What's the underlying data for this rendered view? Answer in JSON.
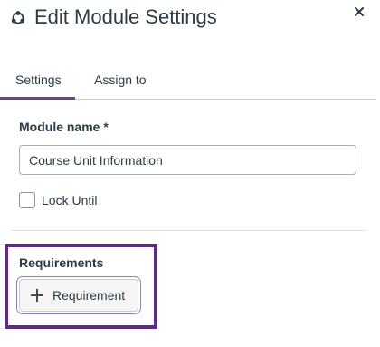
{
  "header": {
    "title": "Edit Module Settings",
    "icon": "module-icon",
    "close_icon": "close-icon"
  },
  "tabs": [
    {
      "label": "Settings",
      "selected": true
    },
    {
      "label": "Assign to",
      "selected": false
    }
  ],
  "form": {
    "module_name_label": "Module name *",
    "module_name_value": "Course Unit Information",
    "lock_until_label": "Lock Until",
    "lock_until_checked": false,
    "requirements_label": "Requirements",
    "add_requirement_label": "Requirement"
  },
  "colors": {
    "tab_accent": "#6b3fa0",
    "highlight_border": "#5e2b80",
    "text": "#2d3b45"
  }
}
